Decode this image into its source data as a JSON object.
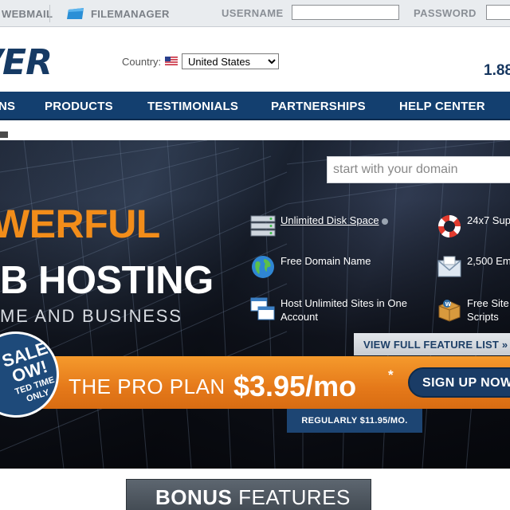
{
  "topbar": {
    "webmail": "WEBMAIL",
    "filemanager": "FILEMANAGER",
    "username_label": "USERNAME",
    "password_label": "PASSWORD",
    "username_value": "",
    "password_value": ""
  },
  "header": {
    "logo_text": "VER",
    "country_label": "Country:",
    "country_selected": "United States",
    "phone": "1.88"
  },
  "nav": {
    "items": [
      "NS",
      "PRODUCTS",
      "TESTIMONIALS",
      "PARTNERSHIPS",
      "HELP CENTER"
    ]
  },
  "hero": {
    "search_placeholder": "start with your domain",
    "headline1": "WERFUL",
    "headline2": "B HOSTING",
    "headline3": "ME AND BUSINESS",
    "features": [
      {
        "icon": "server-icon",
        "label": "Unlimited Disk Space"
      },
      {
        "icon": "lifebuoy-icon",
        "label": "24x7 Sup"
      },
      {
        "icon": "globe-icon",
        "label": "Free Domain Name"
      },
      {
        "icon": "envelope-icon",
        "label": "2,500 Em"
      },
      {
        "icon": "windows-icon",
        "label": "Host Unlimited Sites in One Account"
      },
      {
        "icon": "wordpress-box-icon",
        "label": "Free Site Scripts"
      }
    ],
    "view_full_feature_list": "VIEW FULL FEATURE LIST »",
    "promo": {
      "plan": "THE PRO PLAN",
      "price": "$3.95/mo",
      "asterisk": "*",
      "signup": "SIGN UP NOW",
      "regular": "REGULARLY $11.95/MO."
    },
    "sale_badge": {
      "line1": "SALE",
      "line2": "OW!",
      "line3": "TED TIME",
      "line4": "ONLY"
    }
  },
  "bonus": {
    "bold": "BONUS",
    "rest": " FEATURES"
  },
  "colors": {
    "navy": "#133f6f",
    "orange": "#f28d1a",
    "topbar": "#e9ecef"
  }
}
